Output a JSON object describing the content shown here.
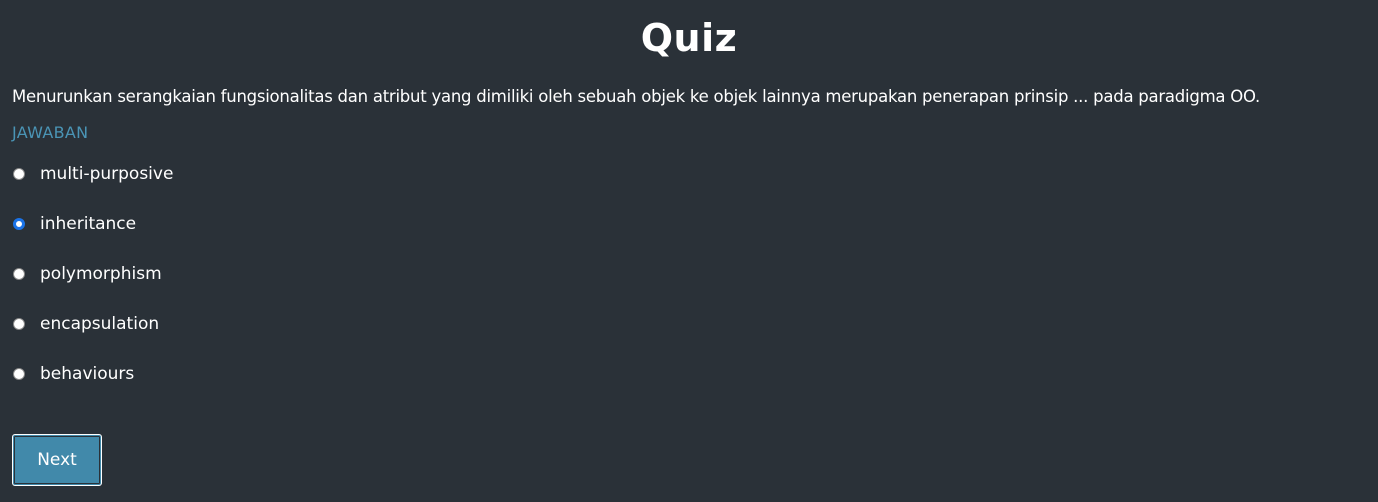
{
  "page": {
    "title": "Quiz"
  },
  "quiz": {
    "question": "Menurunkan serangkaian fungsionalitas dan atribut yang dimiliki oleh sebuah objek ke objek lainnya merupakan penerapan prinsip ... pada paradigma OO.",
    "answer_label": "JAWABAN",
    "options": [
      {
        "label": "multi-purposive",
        "selected": false
      },
      {
        "label": "inheritance",
        "selected": true
      },
      {
        "label": "polymorphism",
        "selected": false
      },
      {
        "label": "encapsulation",
        "selected": false
      },
      {
        "label": "behaviours",
        "selected": false
      }
    ],
    "next_label": "Next"
  },
  "colors": {
    "background": "#2a3138",
    "accent": "#4a94b5",
    "button": "#4189aa",
    "radio_selected": "#1a73e8"
  }
}
